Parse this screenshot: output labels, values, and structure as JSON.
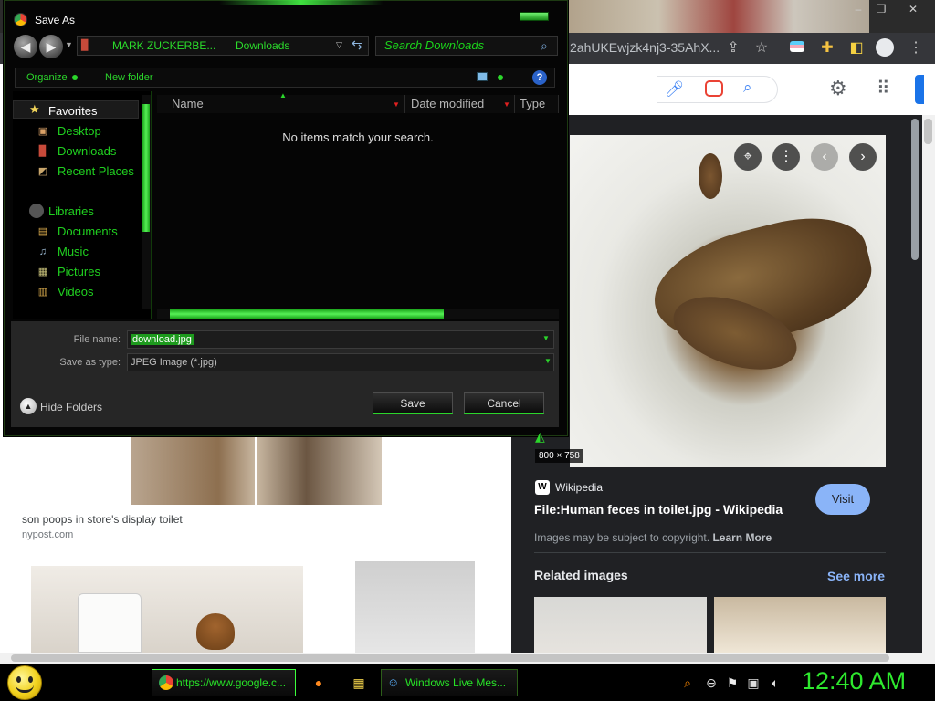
{
  "browser": {
    "address_text": "2ahUKEwjzk4nj3-35AhX...",
    "google_icons": [
      "mic-icon",
      "lens-icon",
      "search-icon"
    ],
    "header_icons": [
      "gear-icon",
      "apps-grid-icon"
    ]
  },
  "results": {
    "item1_caption": "son poops in store's display toilet",
    "item1_source": "nypost.com"
  },
  "preview": {
    "size_badge": "800 × 758",
    "source_name": "Wikipedia",
    "title": "File:Human feces in toilet.jpg - Wikipedia",
    "visit_label": "Visit",
    "copyright_text": "Images may be subject to copyright.",
    "learn_more": "Learn More",
    "related_label": "Related images",
    "see_more": "See more"
  },
  "dialog": {
    "title": "Save As",
    "path_segments": [
      "MARK ZUCKERBE...",
      "Downloads"
    ],
    "search_placeholder": "Search Downloads",
    "organize_label": "Organize",
    "new_folder_label": "New folder",
    "favorites_header": "Favorites",
    "favorites": [
      "Desktop",
      "Downloads",
      "Recent Places"
    ],
    "libraries_header": "Libraries",
    "libraries": [
      "Documents",
      "Music",
      "Pictures",
      "Videos"
    ],
    "columns": [
      "Name",
      "Date modified",
      "Type"
    ],
    "empty_message": "No items match your search.",
    "file_name_label": "File name:",
    "file_name_value": "download.jpg",
    "save_type_label": "Save as type:",
    "save_type_value": "JPEG Image (*.jpg)",
    "hide_folders": "Hide Folders",
    "save_label": "Save",
    "cancel_label": "Cancel"
  },
  "taskbar": {
    "chrome_task": "https://www.google.c...",
    "messenger_task": "Windows Live Mes...",
    "clock": "12:40 AM"
  },
  "colors": {
    "accent_green": "#27e327",
    "visit_button": "#8ab4f8"
  }
}
